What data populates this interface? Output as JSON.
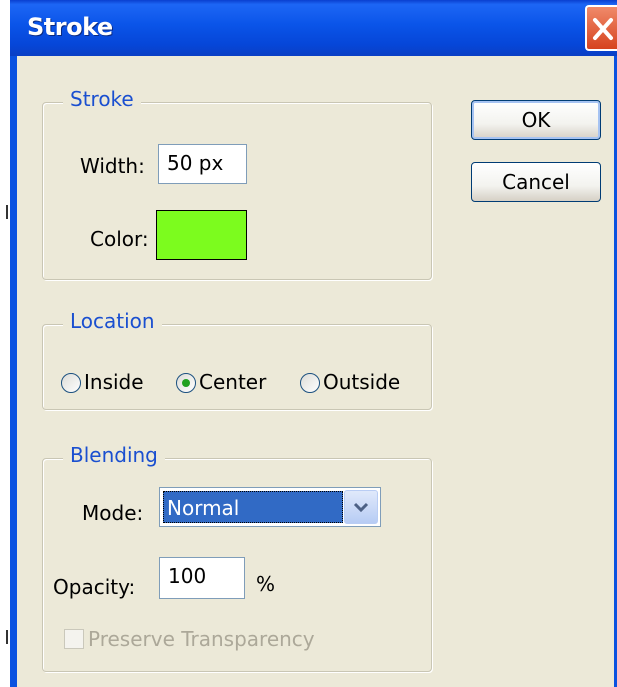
{
  "window": {
    "title": "Stroke"
  },
  "stroke_group": {
    "legend": "Stroke",
    "width_label": "Width:",
    "width_value": "50 px",
    "color_label": "Color:",
    "color_value": "#7cfc1e"
  },
  "location_group": {
    "legend": "Location",
    "options": [
      {
        "label": "Inside",
        "selected": false
      },
      {
        "label": "Center",
        "selected": true
      },
      {
        "label": "Outside",
        "selected": false
      }
    ]
  },
  "blending_group": {
    "legend": "Blending",
    "mode_label": "Mode:",
    "mode_value": "Normal",
    "opacity_label": "Opacity:",
    "opacity_value": "100",
    "opacity_unit": "%",
    "preserve_label": "Preserve Transparency",
    "preserve_checked": false,
    "preserve_enabled": false
  },
  "buttons": {
    "ok_label": "OK",
    "cancel_label": "Cancel"
  },
  "icons": {
    "close": "close-icon",
    "dropdown": "chevron-down-icon"
  },
  "colors": {
    "title_bar": "#0a54e8",
    "dialog_bg": "#ece9d8",
    "legend_text": "#1a4fd0",
    "selection": "#316ac5",
    "close_button": "#d6431f"
  }
}
